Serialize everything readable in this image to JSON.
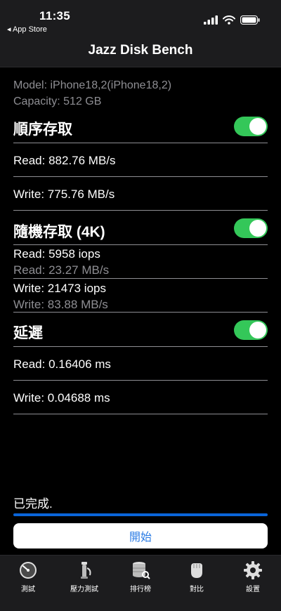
{
  "status_bar": {
    "time": "11:35",
    "back_app": "◂ App Store"
  },
  "nav": {
    "title": "Jazz Disk Bench"
  },
  "device": {
    "model": "Model: iPhone18,2(iPhone18,2)",
    "capacity": "Capacity: 512 GB"
  },
  "sequential": {
    "title": "順序存取",
    "toggle_on": true,
    "read": "Read: 882.76 MB/s",
    "write": "Write: 775.76 MB/s"
  },
  "random": {
    "title": "隨機存取 (4K)",
    "toggle_on": true,
    "read_iops": "Read: 5958 iops",
    "read_mbs": "Read: 23.27 MB/s",
    "write_iops": "Write: 21473 iops",
    "write_mbs": "Write: 83.88 MB/s"
  },
  "latency": {
    "title": "延遲",
    "toggle_on": true,
    "read": "Read: 0.16406 ms",
    "write": "Write: 0.04688 ms"
  },
  "status": {
    "message": "已完成.",
    "progress": 1.0
  },
  "start_button": {
    "label": "開始"
  },
  "tabs": [
    {
      "label": "測試",
      "icon": "speedometer-icon"
    },
    {
      "label": "壓力測試",
      "icon": "pressure-icon"
    },
    {
      "label": "排行榜",
      "icon": "database-search-icon"
    },
    {
      "label": "對比",
      "icon": "fist-icon"
    },
    {
      "label": "設置",
      "icon": "gear-icon"
    }
  ],
  "colors": {
    "accent": "#2a7be4",
    "toggle": "#34c759",
    "progress": "#0a64d8"
  }
}
